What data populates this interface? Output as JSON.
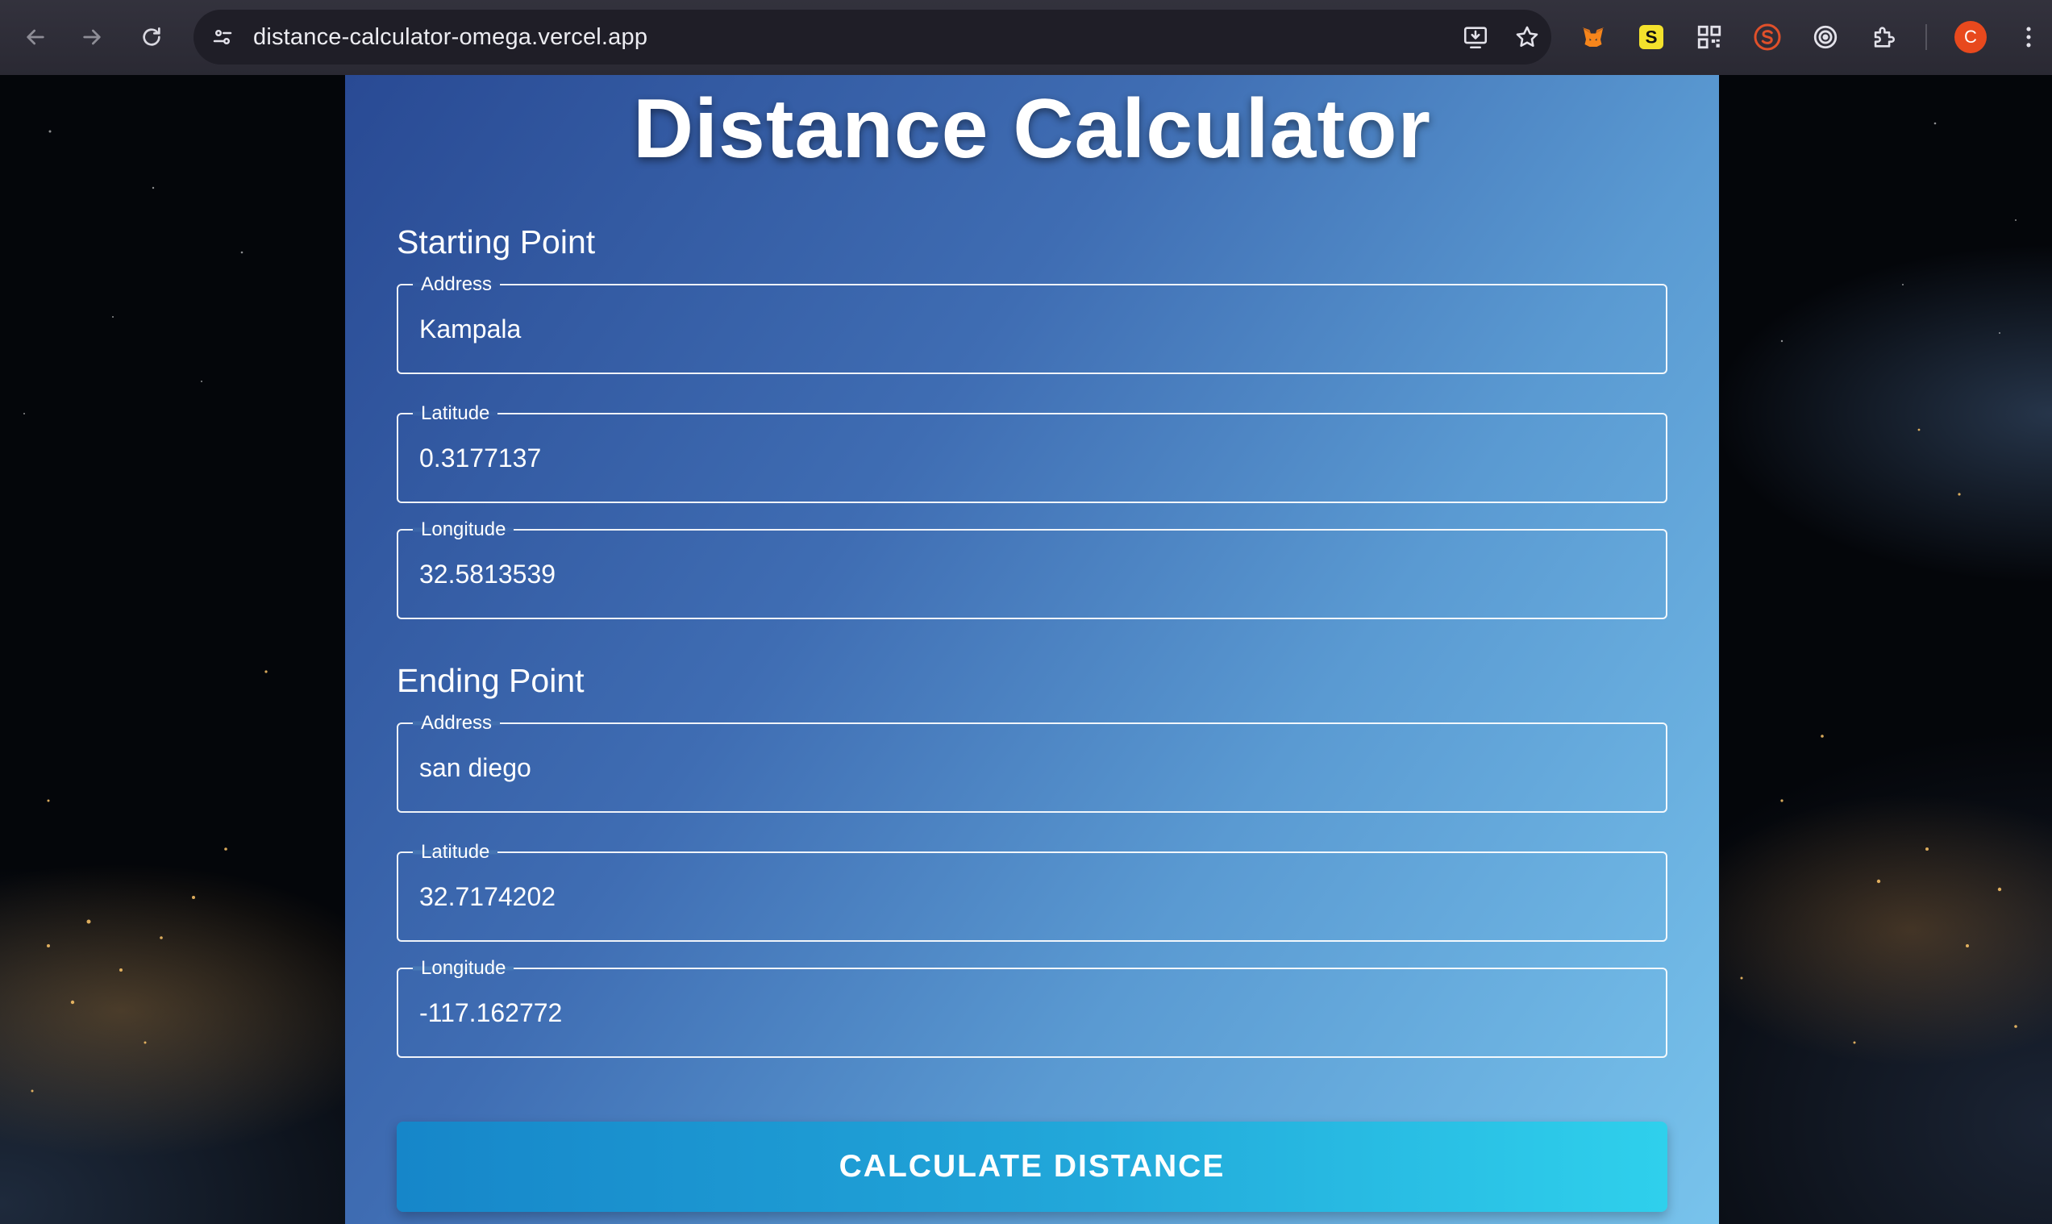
{
  "browser": {
    "url": "distance-calculator-omega.vercel.app",
    "profile_initial": "C",
    "profile_color": "#e8491d"
  },
  "page": {
    "title": "Distance Calculator",
    "starting_point": {
      "heading": "Starting Point",
      "address_label": "Address",
      "address_value": "Kampala",
      "latitude_label": "Latitude",
      "latitude_value": "0.3177137",
      "longitude_label": "Longitude",
      "longitude_value": "32.5813539"
    },
    "ending_point": {
      "heading": "Ending Point",
      "address_label": "Address",
      "address_value": "san diego",
      "latitude_label": "Latitude",
      "latitude_value": "32.7174202",
      "longitude_label": "Longitude",
      "longitude_value": "-117.162772"
    },
    "calculate_label": "CALCULATE DISTANCE"
  },
  "colors": {
    "card_gradient_start": "#294a94",
    "card_gradient_end": "#78c3ec",
    "button_start": "#1686c9",
    "button_end": "#2fd0ec"
  }
}
